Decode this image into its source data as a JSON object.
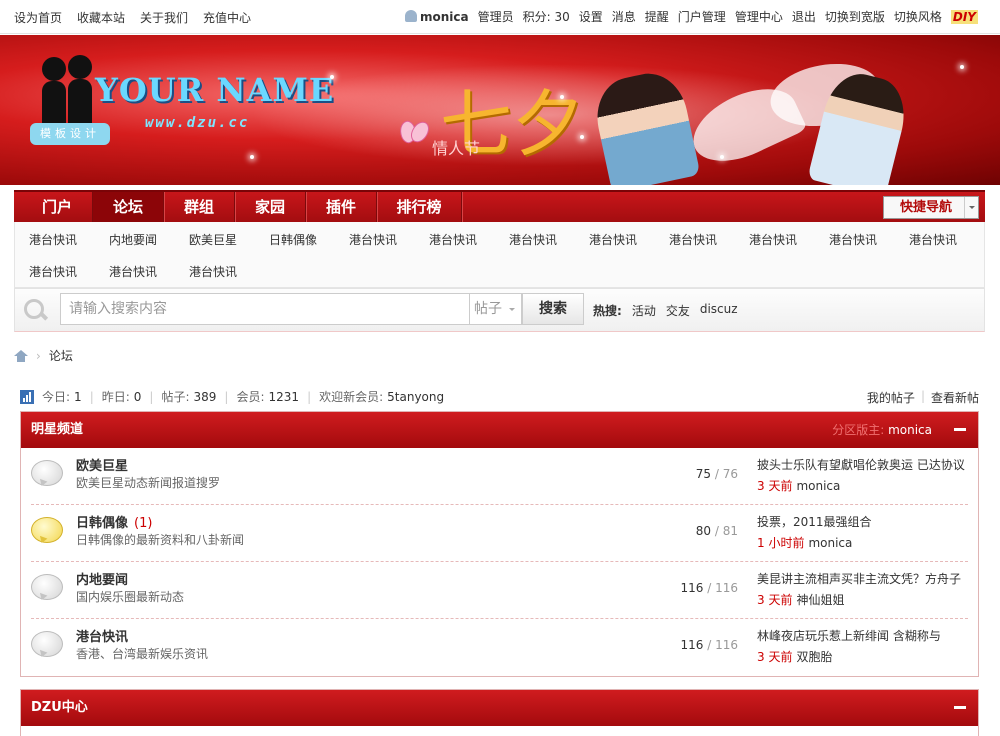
{
  "topbar": {
    "left_links": [
      "设为首页",
      "收藏本站",
      "关于我们",
      "充值中心"
    ],
    "username": "monica",
    "role": "管理员",
    "credits": "积分: 30",
    "right_links": [
      "设置",
      "消息",
      "提醒",
      "门户管理",
      "管理中心",
      "退出",
      "切换到宽版",
      "切换风格"
    ],
    "diy": "DIY"
  },
  "banner": {
    "logo_text": "YOUR NAME",
    "logo_url": "www.dzu.cc",
    "logo_badge": "模板设计",
    "title_char": "七夕",
    "title_sub": "情人节"
  },
  "nav": {
    "items": [
      "门户",
      "论坛",
      "群组",
      "家园",
      "插件",
      "排行榜"
    ],
    "active_index": 1,
    "quick_nav": "快捷导航"
  },
  "subnav": {
    "items": [
      "港台快讯",
      "内地要闻",
      "欧美巨星",
      "日韩偶像",
      "港台快讯",
      "港台快讯",
      "港台快讯",
      "港台快讯",
      "港台快讯",
      "港台快讯",
      "港台快讯",
      "港台快讯",
      "港台快讯",
      "港台快讯",
      "港台快讯"
    ]
  },
  "search": {
    "placeholder": "请输入搜索内容",
    "type": "帖子",
    "button": "搜索",
    "hot_label": "热搜:",
    "hot_items": [
      "活动",
      "交友",
      "discuz"
    ]
  },
  "breadcrumb": {
    "current": "论坛"
  },
  "stats": {
    "today_label": "今日:",
    "today": "1",
    "yesterday_label": "昨日:",
    "yesterday": "0",
    "posts_label": "帖子:",
    "posts": "389",
    "members_label": "会员:",
    "members": "1231",
    "welcome_label": "欢迎新会员:",
    "newest": "5tanyong"
  },
  "my_links": [
    "我的帖子",
    "查看新帖"
  ],
  "categories": [
    {
      "title": "明星频道",
      "moderator_label": "分区版主:",
      "moderator": "monica",
      "forums": [
        {
          "name": "欧美巨星",
          "new": "",
          "desc": "欧美巨星动态新闻报道搜罗",
          "today": "75",
          "total": "76",
          "last_title": "披头士乐队有望獻唱伦敦奥运 已达协议",
          "last_time": "3 天前",
          "last_author": "monica",
          "has_new": false
        },
        {
          "name": "日韩偶像",
          "new": "(1)",
          "desc": "日韩偶像的最新资料和八卦新闻",
          "today": "80",
          "total": "81",
          "last_title": "投票，2011最强组合",
          "last_time": "1 小时前",
          "last_author": "monica",
          "has_new": true
        },
        {
          "name": "内地要闻",
          "new": "",
          "desc": "国内娱乐圈最新动态",
          "today": "116",
          "total": "116",
          "last_title": "美昆讲主流相声买非主流文凭？方舟子",
          "last_time": "3 天前",
          "last_author": "神仙姐姐",
          "has_new": false
        },
        {
          "name": "港台快讯",
          "new": "",
          "desc": "香港、台湾最新娱乐资讯",
          "today": "116",
          "total": "116",
          "last_title": "林峰夜店玩乐惹上新绯闻 含糊称与",
          "last_time": "3 天前",
          "last_author": "双胞胎",
          "has_new": false
        }
      ]
    },
    {
      "title": "DZU中心",
      "forums": []
    }
  ]
}
